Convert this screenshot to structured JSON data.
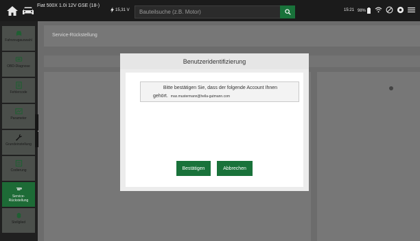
{
  "topbar": {
    "vehicle": "Fiat 500X 1.0i 12V GSE (18-)",
    "voltage": "15,31 V",
    "search_placeholder": "Bauteilsuche (z.B. Motor)",
    "time": "15:21",
    "battery": "98%"
  },
  "sidebar": {
    "items": [
      {
        "label": "Fahrzeugauswahl",
        "icon": "car-icon"
      },
      {
        "label": "OBD-Diagnose",
        "icon": "obd-icon"
      },
      {
        "label": "Fehlercode",
        "icon": "fault-code-icon"
      },
      {
        "label": "Parameter",
        "icon": "parameter-icon"
      },
      {
        "label": "Grundeinstellung",
        "icon": "wrench-icon"
      },
      {
        "label": "Codierung",
        "icon": "coding-icon"
      },
      {
        "label": "Service-Rückstellung",
        "icon": "service-icon"
      },
      {
        "label": "Stellglied",
        "icon": "actuator-icon"
      }
    ],
    "active_index": 6
  },
  "main": {
    "breadcrumb": "Service-Rückstellung"
  },
  "modal": {
    "title": "Benutzeridentifizierung",
    "message_line1": "Bitte bestätigen Sie, dass der folgende Account Ihnen",
    "message_line2": "gehört.",
    "email": "max.mustermann@hella-gutmann.com",
    "confirm_label": "Bestätigen",
    "cancel_label": "Abbrechen"
  },
  "colors": {
    "accent": "#19723a",
    "topbar": "#1b1b1b"
  }
}
